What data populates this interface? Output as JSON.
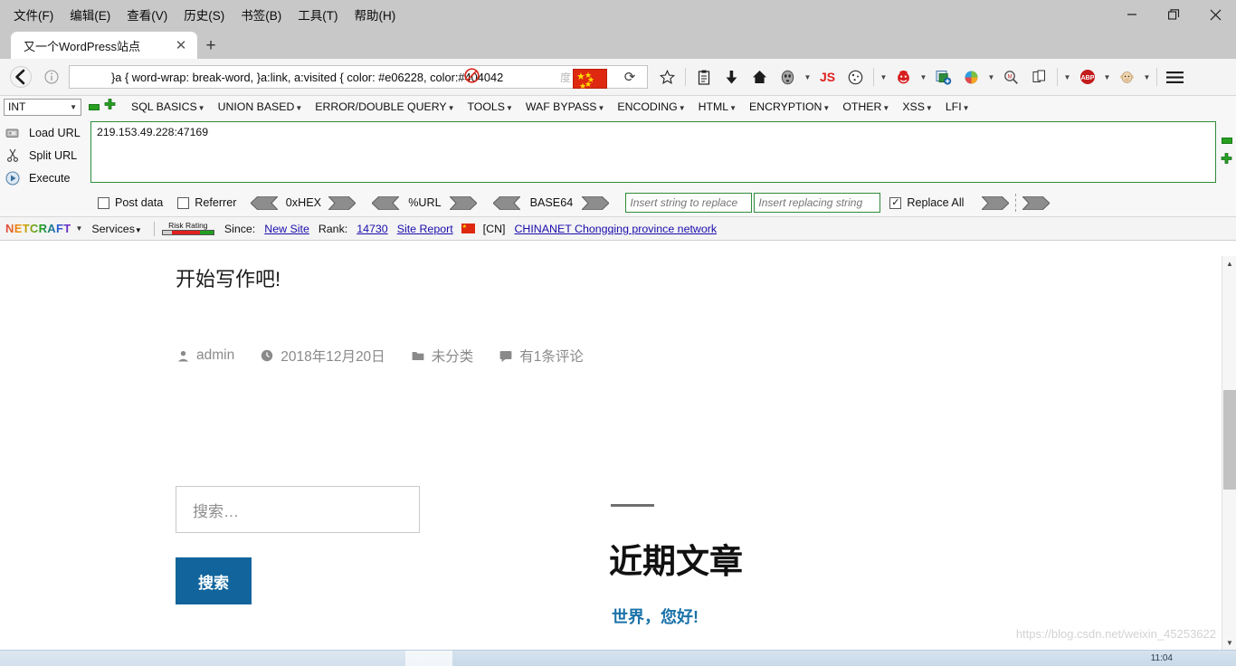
{
  "window": {
    "menus": [
      "文件(F)",
      "编辑(E)",
      "查看(V)",
      "历史(S)",
      "书签(B)",
      "工具(T)",
      "帮助(H)"
    ],
    "controls": {
      "minimize": "minimize",
      "restore": "restore",
      "close": "close"
    }
  },
  "tabs": {
    "active_title": "又一个WordPress站点",
    "close_label": "✕",
    "new_tab_label": "+"
  },
  "navbar": {
    "url_value": "}a { word-wrap: break-word, }a:link, a:visited { color: #e06228, color:#404042",
    "ghost_text": "度",
    "reload_label": "⟳",
    "extensions": [
      "star-icon",
      "clipboard-icon",
      "download-icon",
      "home-icon",
      "mask-icon",
      "js-icon",
      "cookie-icon",
      "clown-icon",
      "app-add-icon",
      "swirl-icon",
      "magnifier-icon",
      "page-icon",
      "abp-icon",
      "monkey-icon",
      "hamburger-menu-icon"
    ],
    "js_label": "JS",
    "abp_label": "ABP"
  },
  "hackbar": {
    "select_value": "INT",
    "menus": [
      "SQL BASICS",
      "UNION BASED",
      "ERROR/DOUBLE QUERY",
      "TOOLS",
      "WAF BYPASS",
      "ENCODING",
      "HTML",
      "ENCRYPTION",
      "OTHER",
      "XSS",
      "LFI"
    ],
    "actions": [
      {
        "label": "Load URL",
        "icon": "load-url-icon"
      },
      {
        "label": "Split URL",
        "icon": "scissors-icon"
      },
      {
        "label": "Execute",
        "icon": "execute-icon"
      }
    ],
    "textarea_value": "219.153.49.228:47169",
    "checkboxes": [
      {
        "label": "Post data",
        "checked": false
      },
      {
        "label": "Referrer",
        "checked": false
      }
    ],
    "encoders": [
      "0xHEX",
      "%URL",
      "BASE64"
    ],
    "replace_from_placeholder": "Insert string to replace",
    "replace_to_placeholder": "Insert replacing string",
    "replace_all_label": "Replace All",
    "replace_all_checked": true
  },
  "netcraft": {
    "brand": "NETCRAFT",
    "services_label": "Services",
    "risk_rating_label": "Risk Rating",
    "since_label": "Since:",
    "since_value": "New Site",
    "rank_label": "Rank:",
    "rank_value": "14730",
    "site_report_label": "Site Report",
    "country_code": "[CN]",
    "network": "CHINANET Chongqing province network"
  },
  "page": {
    "post_title": "开始写作吧!",
    "meta": [
      {
        "icon": "author-icon",
        "text": "admin"
      },
      {
        "icon": "clock-icon",
        "text": "2018年12月20日"
      },
      {
        "icon": "folder-icon",
        "text": "未分类"
      },
      {
        "icon": "comment-icon",
        "text": "有1条评论"
      }
    ],
    "search_placeholder": "搜索…",
    "search_button": "搜索",
    "recent_heading": "近期文章",
    "recent_posts": [
      "世界，您好!"
    ],
    "watermark": "https://blog.csdn.net/weixin_45253622"
  },
  "colors": {
    "accent_blue": "#12659c",
    "link_blue": "#1a72a8",
    "hackbar_green": "#2e8b3a",
    "flag_red": "#de2910"
  },
  "taskbar": {
    "clock": "11:04"
  }
}
